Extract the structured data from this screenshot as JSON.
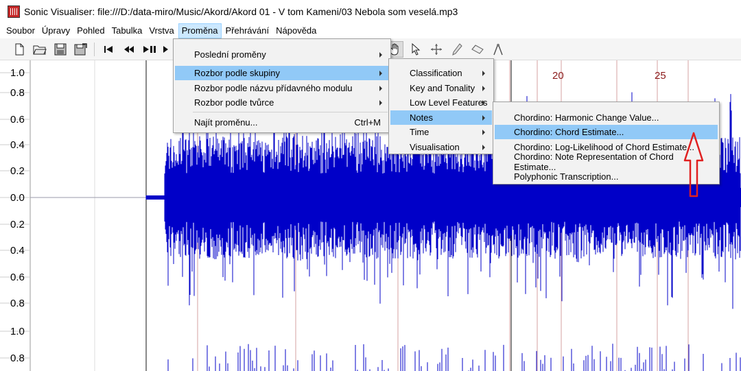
{
  "window": {
    "title": "Sonic Visualiser: file:///D:/data-miro/Music/Akord/Akord 01 - V tom Kameni/03 Nebola som veselá.mp3"
  },
  "menubar": {
    "items": [
      "Soubor",
      "Úpravy",
      "Pohled",
      "Tabulka",
      "Vrstva",
      "Proměna",
      "Přehrávání",
      "Nápověda"
    ],
    "active": "Proměna"
  },
  "menus": {
    "transform": {
      "items": [
        {
          "label": "Poslední proměny",
          "submenu": true
        },
        {
          "label": "Rozbor podle skupiny",
          "submenu": true,
          "highlighted": true
        },
        {
          "label": "Rozbor podle názvu přídavného modulu",
          "submenu": true
        },
        {
          "label": "Rozbor podle tvůrce",
          "submenu": true
        },
        {
          "label": "Najít proměnu...",
          "shortcut": "Ctrl+M"
        }
      ]
    },
    "category": {
      "items": [
        {
          "label": "Classification",
          "submenu": true
        },
        {
          "label": "Key and Tonality",
          "submenu": true
        },
        {
          "label": "Low Level Features",
          "submenu": true
        },
        {
          "label": "Notes",
          "submenu": true,
          "highlighted": true
        },
        {
          "label": "Time",
          "submenu": true
        },
        {
          "label": "Visualisation",
          "submenu": true
        }
      ]
    },
    "notes": {
      "items": [
        {
          "label": "Chordino: Harmonic Change Value..."
        },
        {
          "label": "Chordino: Chord Estimate...",
          "highlighted": true
        },
        {
          "label": "Chordino: Log-Likelihood of Chord Estimate..."
        },
        {
          "label": "Chordino: Note Representation of Chord Estimate..."
        },
        {
          "label": "Polyphonic Transcription..."
        }
      ]
    }
  },
  "toolbar": {
    "icons": [
      "new-file-icon",
      "open-folder-icon",
      "save-icon",
      "save-session-icon",
      "skip-to-start-icon",
      "rewind-icon",
      "play-pause-icon",
      "fast-forward-icon",
      "navigate-hand-icon",
      "select-pointer-icon",
      "move-cross-icon",
      "draw-pencil-icon",
      "erase-icon",
      "measure-compass-icon"
    ]
  },
  "waveform": {
    "y_axis_labels": [
      "1.0",
      "0.8",
      "0.6",
      "0.4",
      "0.2",
      "0.0",
      "0.2",
      "0.4",
      "0.6",
      "0.8",
      "1.0",
      "0.8"
    ],
    "time_ticks": [
      "20",
      "25"
    ],
    "colors": {
      "waveform": "#0000c8",
      "beat_lines": "#d4a0a0",
      "tick_label": "#8b1a1a",
      "annotation": "#e02020"
    }
  }
}
